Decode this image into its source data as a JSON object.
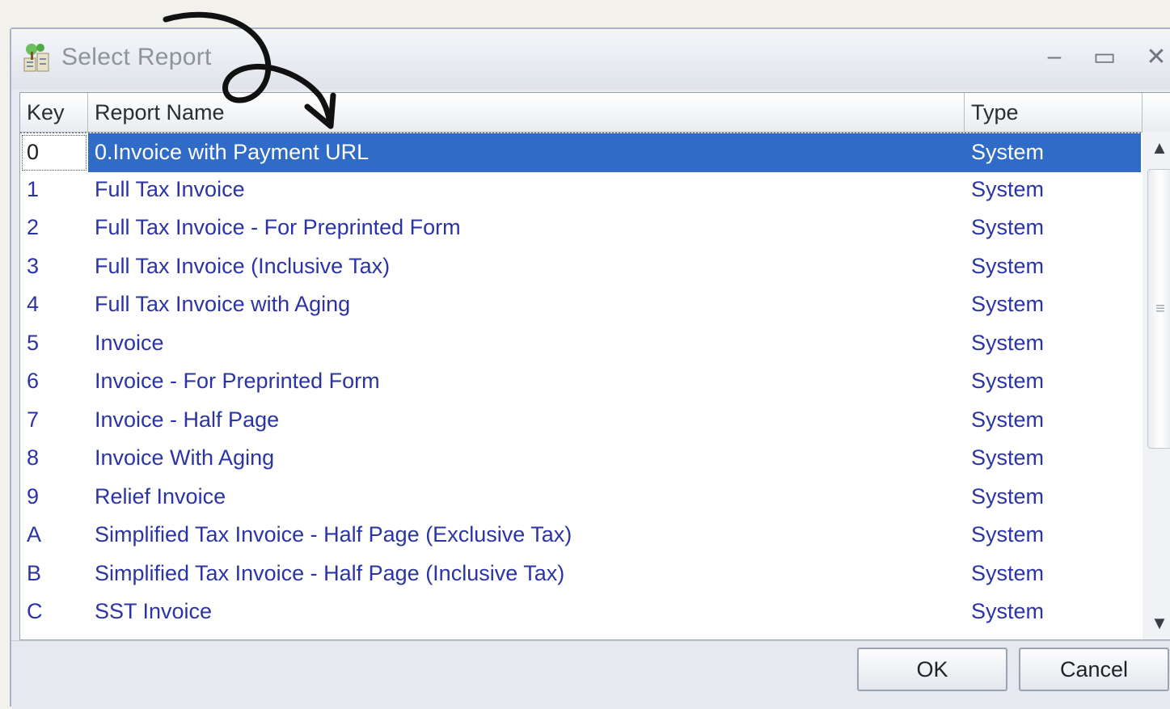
{
  "window": {
    "title": "Select Report",
    "controls": {
      "minimize": "–",
      "maximize": "▭",
      "close": "✕"
    }
  },
  "grid": {
    "columns": {
      "key": "Key",
      "name": "Report Name",
      "type": "Type"
    },
    "rows": [
      {
        "key": "0",
        "name": "0.Invoice with Payment URL",
        "type": "System",
        "selected": true
      },
      {
        "key": "1",
        "name": "Full Tax Invoice",
        "type": "System"
      },
      {
        "key": "2",
        "name": "Full Tax Invoice - For Preprinted Form",
        "type": "System"
      },
      {
        "key": "3",
        "name": "Full Tax Invoice (Inclusive Tax)",
        "type": "System"
      },
      {
        "key": "4",
        "name": "Full Tax Invoice with Aging",
        "type": "System"
      },
      {
        "key": "5",
        "name": "Invoice",
        "type": "System"
      },
      {
        "key": "6",
        "name": "Invoice - For Preprinted Form",
        "type": "System"
      },
      {
        "key": "7",
        "name": "Invoice - Half Page",
        "type": "System"
      },
      {
        "key": "8",
        "name": "Invoice With Aging",
        "type": "System"
      },
      {
        "key": "9",
        "name": "Relief Invoice",
        "type": "System"
      },
      {
        "key": "A",
        "name": "Simplified Tax Invoice - Half Page (Exclusive Tax)",
        "type": "System"
      },
      {
        "key": "B",
        "name": "Simplified Tax Invoice - Half Page (Inclusive Tax)",
        "type": "System"
      },
      {
        "key": "C",
        "name": "SST Invoice",
        "type": "System"
      }
    ]
  },
  "buttons": {
    "ok": "OK",
    "cancel": "Cancel"
  },
  "icons": {
    "app": "report-tree-icon",
    "scroll_up": "chevron-up-icon",
    "scroll_down": "chevron-down-icon",
    "annotation": "hand-drawn-arrow-icon"
  },
  "colors": {
    "selection": "#2f6bc7",
    "row_text": "#2b34a6",
    "title_text": "#8d949c"
  }
}
